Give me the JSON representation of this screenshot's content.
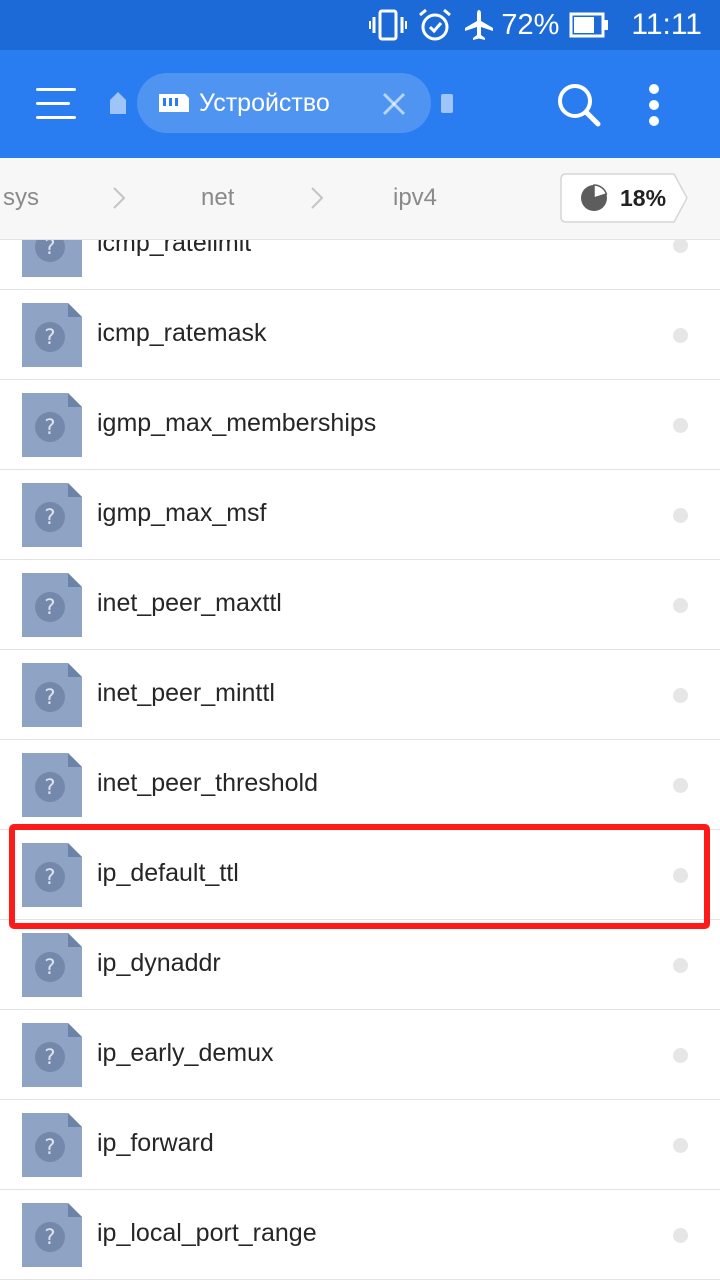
{
  "status_bar": {
    "battery_percent": "72%",
    "time": "11:11",
    "icons": [
      "vibrate-icon",
      "alarm-icon",
      "airplane-mode-icon",
      "battery-icon"
    ]
  },
  "toolbar": {
    "menu_icon": "hamburger-menu-icon",
    "tab_label": "Устройство",
    "tab_icon": "sd-card-icon",
    "search_icon": "search-icon",
    "more_icon": "more-vertical-icon",
    "accent_color": "#2a7df0",
    "status_color": "#1c6ad7"
  },
  "breadcrumb": {
    "items": [
      "sys",
      "net",
      "ipv4"
    ],
    "storage_usage": "18%"
  },
  "file_list": {
    "items": [
      {
        "name": "icmp_ratelimit"
      },
      {
        "name": "icmp_ratemask"
      },
      {
        "name": "igmp_max_memberships"
      },
      {
        "name": "igmp_max_msf"
      },
      {
        "name": "inet_peer_maxttl"
      },
      {
        "name": "inet_peer_minttl"
      },
      {
        "name": "inet_peer_threshold"
      },
      {
        "name": "ip_default_ttl",
        "highlighted": true
      },
      {
        "name": "ip_dynaddr"
      },
      {
        "name": "ip_early_demux"
      },
      {
        "name": "ip_forward"
      },
      {
        "name": "ip_local_port_range"
      }
    ],
    "file_icon": "unknown-file-icon",
    "highlight_color": "#ff1a1a"
  }
}
